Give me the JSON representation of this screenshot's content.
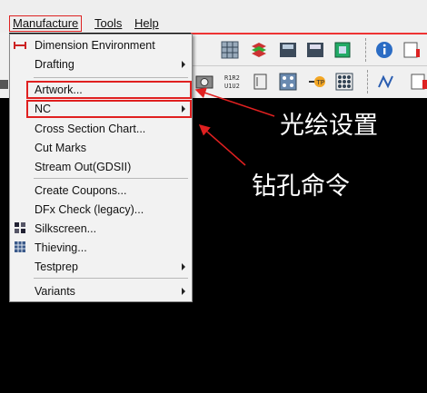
{
  "menubar": {
    "items": [
      {
        "label": "Manufacture",
        "active": true
      },
      {
        "label": "Tools",
        "active": false
      },
      {
        "label": "Help",
        "active": false
      }
    ]
  },
  "menu": {
    "items": [
      {
        "label": "Dimension Environment",
        "submenu": false,
        "icon": "dimension-icon"
      },
      {
        "label": "Drafting",
        "submenu": true
      },
      {
        "label": "Artwork...",
        "submenu": false,
        "highlighted": true
      },
      {
        "label": "NC",
        "submenu": true,
        "highlighted": true
      },
      {
        "label": "Cross Section Chart...",
        "submenu": false
      },
      {
        "label": "Cut Marks",
        "submenu": false
      },
      {
        "label": "Stream Out(GDSII)",
        "submenu": false
      },
      {
        "label": "Create Coupons...",
        "submenu": false
      },
      {
        "label": "DFx Check (legacy)...",
        "submenu": false
      },
      {
        "label": "Silkscreen...",
        "submenu": false,
        "icon": "silkscreen-icon"
      },
      {
        "label": "Thieving...",
        "submenu": false,
        "icon": "thieving-icon"
      },
      {
        "label": "Testprep",
        "submenu": true
      },
      {
        "label": "Variants",
        "submenu": true
      }
    ]
  },
  "annotations": {
    "artwork_note": "光绘设置",
    "nc_note": "钻孔命令"
  },
  "colors": {
    "highlight": "#e02020",
    "background": "#000000",
    "menu_bg": "#f2f2f2"
  }
}
